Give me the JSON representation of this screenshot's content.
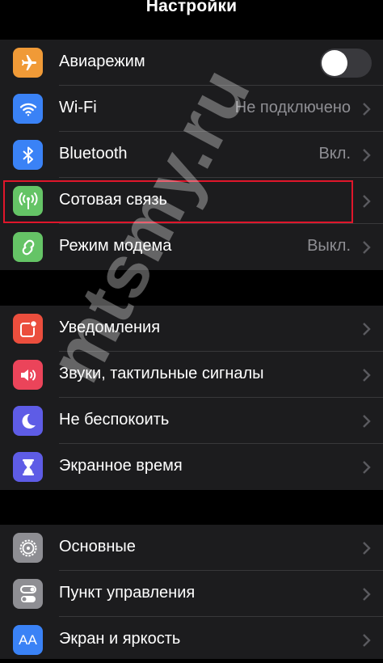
{
  "header": {
    "title": "Настройки"
  },
  "group1": {
    "items": [
      {
        "label": "Авиарежим",
        "icon": "airplane-icon",
        "color": "#f09a37"
      },
      {
        "label": "Wi-Fi",
        "value": "Не подключено",
        "icon": "wifi-icon",
        "color": "#3a82f6"
      },
      {
        "label": "Bluetooth",
        "value": "Вкл.",
        "icon": "bluetooth-icon",
        "color": "#3a82f6"
      },
      {
        "label": "Сотовая связь",
        "icon": "cellular-antenna-icon",
        "color": "#65c466"
      },
      {
        "label": "Режим модема",
        "value": "Выкл.",
        "icon": "personal-hotspot-icon",
        "color": "#65c466"
      }
    ],
    "airplane_toggle": "off"
  },
  "group2": {
    "items": [
      {
        "label": "Уведомления",
        "icon": "notifications-icon",
        "color": "#eb4e3d"
      },
      {
        "label": "Звуки, тактильные сигналы",
        "icon": "speaker-icon",
        "color": "#eb445a"
      },
      {
        "label": "Не беспокоить",
        "icon": "moon-icon",
        "color": "#5e5ce6"
      },
      {
        "label": "Экранное время",
        "icon": "hourglass-icon",
        "color": "#5e5ce6"
      }
    ]
  },
  "group3": {
    "items": [
      {
        "label": "Основные",
        "icon": "gear-icon",
        "color": "#8e8e93"
      },
      {
        "label": "Пункт управления",
        "icon": "control-center-icon",
        "color": "#8e8e93"
      },
      {
        "label": "Экран и яркость",
        "icon": "display-brightness-icon",
        "icon_text": "AA",
        "color": "#3a82f6"
      }
    ]
  },
  "highlight_color": "#e0162b",
  "watermark": "mtsmy.ru"
}
